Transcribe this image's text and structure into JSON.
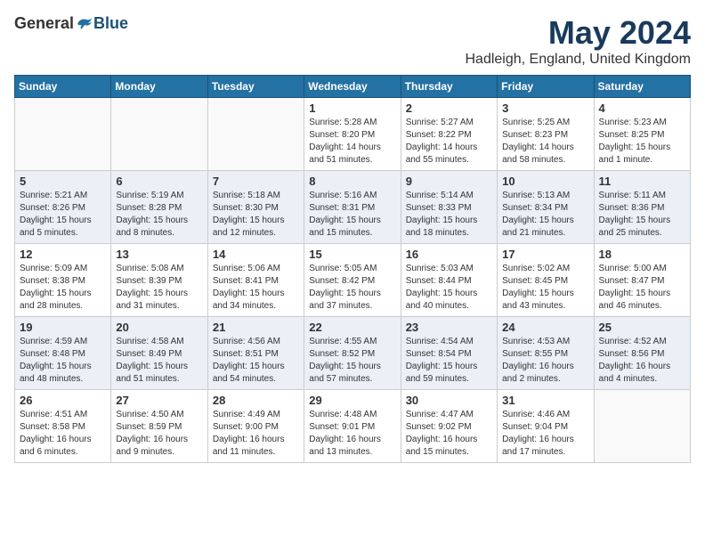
{
  "header": {
    "logo_general": "General",
    "logo_blue": "Blue",
    "month": "May 2024",
    "location": "Hadleigh, England, United Kingdom"
  },
  "weekdays": [
    "Sunday",
    "Monday",
    "Tuesday",
    "Wednesday",
    "Thursday",
    "Friday",
    "Saturday"
  ],
  "weeks": [
    [
      {
        "day": "",
        "info": ""
      },
      {
        "day": "",
        "info": ""
      },
      {
        "day": "",
        "info": ""
      },
      {
        "day": "1",
        "info": "Sunrise: 5:28 AM\nSunset: 8:20 PM\nDaylight: 14 hours\nand 51 minutes."
      },
      {
        "day": "2",
        "info": "Sunrise: 5:27 AM\nSunset: 8:22 PM\nDaylight: 14 hours\nand 55 minutes."
      },
      {
        "day": "3",
        "info": "Sunrise: 5:25 AM\nSunset: 8:23 PM\nDaylight: 14 hours\nand 58 minutes."
      },
      {
        "day": "4",
        "info": "Sunrise: 5:23 AM\nSunset: 8:25 PM\nDaylight: 15 hours\nand 1 minute."
      }
    ],
    [
      {
        "day": "5",
        "info": "Sunrise: 5:21 AM\nSunset: 8:26 PM\nDaylight: 15 hours\nand 5 minutes."
      },
      {
        "day": "6",
        "info": "Sunrise: 5:19 AM\nSunset: 8:28 PM\nDaylight: 15 hours\nand 8 minutes."
      },
      {
        "day": "7",
        "info": "Sunrise: 5:18 AM\nSunset: 8:30 PM\nDaylight: 15 hours\nand 12 minutes."
      },
      {
        "day": "8",
        "info": "Sunrise: 5:16 AM\nSunset: 8:31 PM\nDaylight: 15 hours\nand 15 minutes."
      },
      {
        "day": "9",
        "info": "Sunrise: 5:14 AM\nSunset: 8:33 PM\nDaylight: 15 hours\nand 18 minutes."
      },
      {
        "day": "10",
        "info": "Sunrise: 5:13 AM\nSunset: 8:34 PM\nDaylight: 15 hours\nand 21 minutes."
      },
      {
        "day": "11",
        "info": "Sunrise: 5:11 AM\nSunset: 8:36 PM\nDaylight: 15 hours\nand 25 minutes."
      }
    ],
    [
      {
        "day": "12",
        "info": "Sunrise: 5:09 AM\nSunset: 8:38 PM\nDaylight: 15 hours\nand 28 minutes."
      },
      {
        "day": "13",
        "info": "Sunrise: 5:08 AM\nSunset: 8:39 PM\nDaylight: 15 hours\nand 31 minutes."
      },
      {
        "day": "14",
        "info": "Sunrise: 5:06 AM\nSunset: 8:41 PM\nDaylight: 15 hours\nand 34 minutes."
      },
      {
        "day": "15",
        "info": "Sunrise: 5:05 AM\nSunset: 8:42 PM\nDaylight: 15 hours\nand 37 minutes."
      },
      {
        "day": "16",
        "info": "Sunrise: 5:03 AM\nSunset: 8:44 PM\nDaylight: 15 hours\nand 40 minutes."
      },
      {
        "day": "17",
        "info": "Sunrise: 5:02 AM\nSunset: 8:45 PM\nDaylight: 15 hours\nand 43 minutes."
      },
      {
        "day": "18",
        "info": "Sunrise: 5:00 AM\nSunset: 8:47 PM\nDaylight: 15 hours\nand 46 minutes."
      }
    ],
    [
      {
        "day": "19",
        "info": "Sunrise: 4:59 AM\nSunset: 8:48 PM\nDaylight: 15 hours\nand 48 minutes."
      },
      {
        "day": "20",
        "info": "Sunrise: 4:58 AM\nSunset: 8:49 PM\nDaylight: 15 hours\nand 51 minutes."
      },
      {
        "day": "21",
        "info": "Sunrise: 4:56 AM\nSunset: 8:51 PM\nDaylight: 15 hours\nand 54 minutes."
      },
      {
        "day": "22",
        "info": "Sunrise: 4:55 AM\nSunset: 8:52 PM\nDaylight: 15 hours\nand 57 minutes."
      },
      {
        "day": "23",
        "info": "Sunrise: 4:54 AM\nSunset: 8:54 PM\nDaylight: 15 hours\nand 59 minutes."
      },
      {
        "day": "24",
        "info": "Sunrise: 4:53 AM\nSunset: 8:55 PM\nDaylight: 16 hours\nand 2 minutes."
      },
      {
        "day": "25",
        "info": "Sunrise: 4:52 AM\nSunset: 8:56 PM\nDaylight: 16 hours\nand 4 minutes."
      }
    ],
    [
      {
        "day": "26",
        "info": "Sunrise: 4:51 AM\nSunset: 8:58 PM\nDaylight: 16 hours\nand 6 minutes."
      },
      {
        "day": "27",
        "info": "Sunrise: 4:50 AM\nSunset: 8:59 PM\nDaylight: 16 hours\nand 9 minutes."
      },
      {
        "day": "28",
        "info": "Sunrise: 4:49 AM\nSunset: 9:00 PM\nDaylight: 16 hours\nand 11 minutes."
      },
      {
        "day": "29",
        "info": "Sunrise: 4:48 AM\nSunset: 9:01 PM\nDaylight: 16 hours\nand 13 minutes."
      },
      {
        "day": "30",
        "info": "Sunrise: 4:47 AM\nSunset: 9:02 PM\nDaylight: 16 hours\nand 15 minutes."
      },
      {
        "day": "31",
        "info": "Sunrise: 4:46 AM\nSunset: 9:04 PM\nDaylight: 16 hours\nand 17 minutes."
      },
      {
        "day": "",
        "info": ""
      }
    ]
  ]
}
